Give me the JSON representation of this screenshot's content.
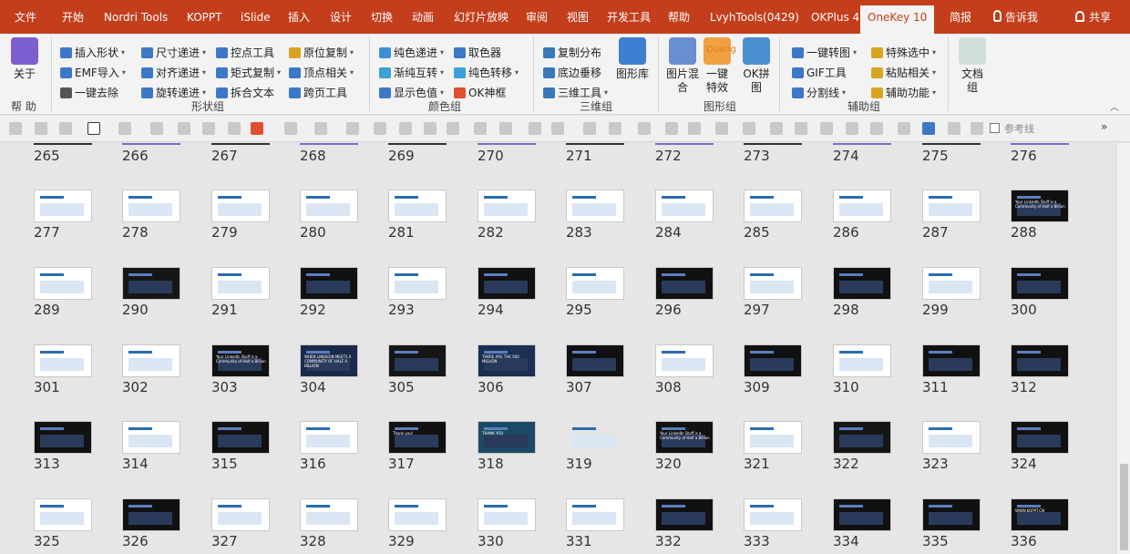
{
  "tabs": [
    "文件",
    "开始",
    "Nordri Tools",
    "KOPPT",
    "iSlide",
    "插入",
    "设计",
    "切换",
    "动画",
    "幻灯片放映",
    "审阅",
    "视图",
    "开发工具",
    "帮助",
    "LvyhTools(0429)",
    "OKPlus 4",
    "OneKey 10",
    "简报",
    "告诉我",
    "共享"
  ],
  "ribbon": {
    "about": "关于",
    "group_help": "帮 助",
    "shape_items": [
      "插入形状",
      "EMF导入",
      "一键去除",
      "尺寸递进",
      "对齐递进",
      "旋转递进",
      "控点工具",
      "矩式复制",
      "拆合文本",
      "原位复制",
      "顶点相关",
      "跨页工具"
    ],
    "group_shape": "形状组",
    "color_items": [
      "纯色递进",
      "渐纯互转",
      "显示色值",
      "取色器",
      "纯色转移",
      "OK神框"
    ],
    "group_color": "颜色组",
    "three_d_items": [
      "复制分布",
      "底边垂移",
      "三维工具"
    ],
    "shape_lib": "图形库",
    "group_3d": "三维组",
    "picture_items": [
      "图片混合",
      "一键特效",
      "OK拼图"
    ],
    "duang": "Duang",
    "group_picture": "图形组",
    "aux_items": [
      "一键转图",
      "GIF工具",
      "分割线",
      "特殊选中",
      "粘贴相关",
      "辅助功能"
    ],
    "group_aux": "辅助组",
    "doc_group": "文档组",
    "ref_line": "参考线"
  },
  "slides": [
    {
      "n": 265
    },
    {
      "n": 266
    },
    {
      "n": 267
    },
    {
      "n": 268
    },
    {
      "n": 269
    },
    {
      "n": 270
    },
    {
      "n": 271
    },
    {
      "n": 272
    },
    {
      "n": 273
    },
    {
      "n": 274
    },
    {
      "n": 275
    },
    {
      "n": 276
    },
    {
      "n": 277,
      "bg": "#ffffff"
    },
    {
      "n": 278,
      "bg": "#ffffff"
    },
    {
      "n": 279,
      "bg": "#ffffff"
    },
    {
      "n": 280,
      "bg": "#ffffff"
    },
    {
      "n": 281,
      "bg": "#ffffff"
    },
    {
      "n": 282,
      "bg": "#ffffff"
    },
    {
      "n": 283,
      "bg": "#ffffff"
    },
    {
      "n": 284,
      "bg": "#ffffff"
    },
    {
      "n": 285,
      "bg": "#ffffff"
    },
    {
      "n": 286,
      "bg": "#ffffff"
    },
    {
      "n": 287,
      "bg": "#ffffff"
    },
    {
      "n": 288,
      "bg": "#111111"
    },
    {
      "n": 289,
      "bg": "#ffffff"
    },
    {
      "n": 290,
      "bg": "#161616"
    },
    {
      "n": 291,
      "bg": "#ffffff"
    },
    {
      "n": 292,
      "bg": "#111111"
    },
    {
      "n": 293,
      "bg": "#ffffff"
    },
    {
      "n": 294,
      "bg": "#111111"
    },
    {
      "n": 295,
      "bg": "#ffffff"
    },
    {
      "n": 296,
      "bg": "#111111"
    },
    {
      "n": 297,
      "bg": "#ffffff"
    },
    {
      "n": 298,
      "bg": "#111111"
    },
    {
      "n": 299,
      "bg": "#ffffff"
    },
    {
      "n": 300,
      "bg": "#111111"
    },
    {
      "n": 301,
      "bg": "#ffffff"
    },
    {
      "n": 302,
      "bg": "#ffffff"
    },
    {
      "n": 303,
      "bg": "#111111"
    },
    {
      "n": 304,
      "bg": "#1b2a4a"
    },
    {
      "n": 305,
      "bg": "#161616"
    },
    {
      "n": 306,
      "bg": "#1a2f52"
    },
    {
      "n": 307,
      "bg": "#111111"
    },
    {
      "n": 308,
      "bg": "#ffffff"
    },
    {
      "n": 309,
      "bg": "#111111"
    },
    {
      "n": 310,
      "bg": "#ffffff"
    },
    {
      "n": 311,
      "bg": "#111111"
    },
    {
      "n": 312,
      "bg": "#111111"
    },
    {
      "n": 313,
      "bg": "#111111"
    },
    {
      "n": 314,
      "bg": "#ffffff"
    },
    {
      "n": 315,
      "bg": "#111111"
    },
    {
      "n": 316,
      "bg": "#ffffff"
    },
    {
      "n": 317,
      "bg": "#111111"
    },
    {
      "n": 318,
      "bg": "#1c4a66"
    },
    {
      "n": 319,
      "bg": "#e6e6e6"
    },
    {
      "n": 320,
      "bg": "#111111"
    },
    {
      "n": 321,
      "bg": "#ffffff"
    },
    {
      "n": 322,
      "bg": "#161616"
    },
    {
      "n": 323,
      "bg": "#ffffff"
    },
    {
      "n": 324,
      "bg": "#111111"
    },
    {
      "n": 325,
      "bg": "#ffffff"
    },
    {
      "n": 326,
      "bg": "#111111"
    },
    {
      "n": 327,
      "bg": "#ffffff"
    },
    {
      "n": 328,
      "bg": "#ffffff"
    },
    {
      "n": 329,
      "bg": "#ffffff"
    },
    {
      "n": 330,
      "bg": "#ffffff"
    },
    {
      "n": 331,
      "bg": "#ffffff"
    },
    {
      "n": 332,
      "bg": "#111111"
    },
    {
      "n": 333,
      "bg": "#ffffff"
    },
    {
      "n": 334,
      "bg": "#111111"
    },
    {
      "n": 335,
      "bg": "#111111"
    },
    {
      "n": 336,
      "bg": "#111111"
    }
  ],
  "slide_texts": {
    "288": "Your LinkedIn Stuff is a Community of Half a Billion",
    "303": "Your LinkedIn Stuff is a Community of Half a Billion",
    "304": "WHEN LINKEDIN MEETS A COMMUNITY OF HALF A BILLION",
    "306": "THERE ARE THE 500 MILLION",
    "317": "Thank you!",
    "318": "THANK YOU",
    "320": "Your LinkedIn Stuff is a Community of Half a Billion",
    "336": "WWW.KOPPT.CN"
  },
  "colors": {
    "accent": "#c43e1c",
    "ribbon": "#f3f3f3",
    "canvas": "#e6e6e6"
  }
}
